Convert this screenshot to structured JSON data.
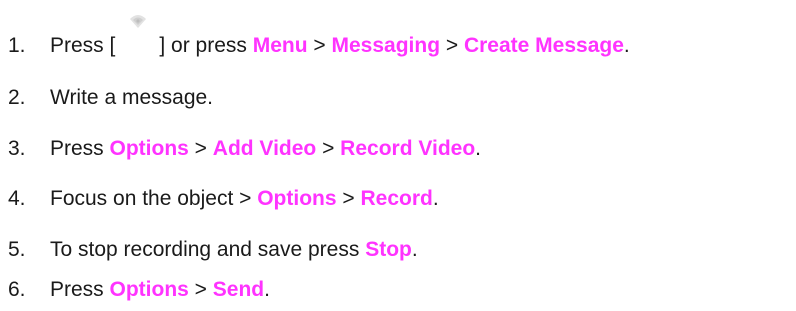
{
  "steps": [
    {
      "number": "1.",
      "parts": [
        {
          "text": "Press [",
          "kind": "text"
        },
        {
          "text": "",
          "kind": "icon",
          "icon": "message-softkey-icon"
        },
        {
          "text": "] or press ",
          "kind": "text"
        },
        {
          "text": "Menu",
          "kind": "keyword"
        },
        {
          "text": " > ",
          "kind": "text"
        },
        {
          "text": "Messaging",
          "kind": "keyword"
        },
        {
          "text": " > ",
          "kind": "text"
        },
        {
          "text": "Create Message",
          "kind": "keyword"
        },
        {
          "text": ".",
          "kind": "text"
        }
      ]
    },
    {
      "number": "2.",
      "parts": [
        {
          "text": "Write a message.",
          "kind": "text"
        }
      ]
    },
    {
      "number": "3.",
      "parts": [
        {
          "text": "Press ",
          "kind": "text"
        },
        {
          "text": "Options",
          "kind": "keyword"
        },
        {
          "text": " > ",
          "kind": "text"
        },
        {
          "text": "Add Video",
          "kind": "keyword"
        },
        {
          "text": " > ",
          "kind": "text"
        },
        {
          "text": "Record Video",
          "kind": "keyword"
        },
        {
          "text": ".",
          "kind": "text"
        }
      ]
    },
    {
      "number": "4.",
      "parts": [
        {
          "text": "Focus on the object > ",
          "kind": "text"
        },
        {
          "text": "Options",
          "kind": "keyword"
        },
        {
          "text": " > ",
          "kind": "text"
        },
        {
          "text": "Record",
          "kind": "keyword"
        },
        {
          "text": ".",
          "kind": "text"
        }
      ]
    },
    {
      "number": "5.",
      "parts": [
        {
          "text": "To stop recording and save press ",
          "kind": "text"
        },
        {
          "text": "Stop",
          "kind": "keyword"
        },
        {
          "text": ".",
          "kind": "text"
        }
      ]
    },
    {
      "number": "6.",
      "parts": [
        {
          "text": "Press ",
          "kind": "text"
        },
        {
          "text": "Options",
          "kind": "keyword"
        },
        {
          "text": " > ",
          "kind": "text"
        },
        {
          "text": "Send",
          "kind": "keyword"
        },
        {
          "text": ".",
          "kind": "text"
        }
      ]
    }
  ],
  "colors": {
    "keyword": "#ff33ff",
    "text": "#1a1a1a"
  }
}
